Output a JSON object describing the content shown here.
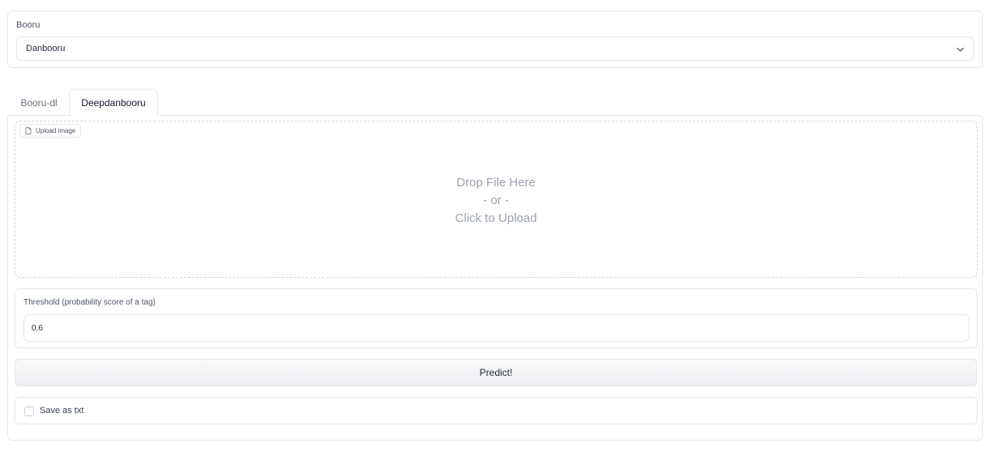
{
  "booru": {
    "label": "Booru",
    "selected": "Danbooru"
  },
  "tabs": [
    {
      "label": "Booru-dl",
      "active": false
    },
    {
      "label": "Deepdanbooru",
      "active": true
    }
  ],
  "upload": {
    "chip_label": "Upload image",
    "line1": "Drop File Here",
    "line2": "- or -",
    "line3": "Click to Upload"
  },
  "threshold": {
    "label": "Threshold (probability score of a tag)",
    "value": "0.6"
  },
  "predict": {
    "label": "Predict!"
  },
  "save": {
    "label": "Save as txt",
    "checked": false
  },
  "icons": {
    "dropdown": "chevron-down-icon",
    "upload_chip": "file-icon"
  },
  "colors": {
    "border": "#e5e7eb",
    "placeholder_text": "#9ca3af"
  }
}
